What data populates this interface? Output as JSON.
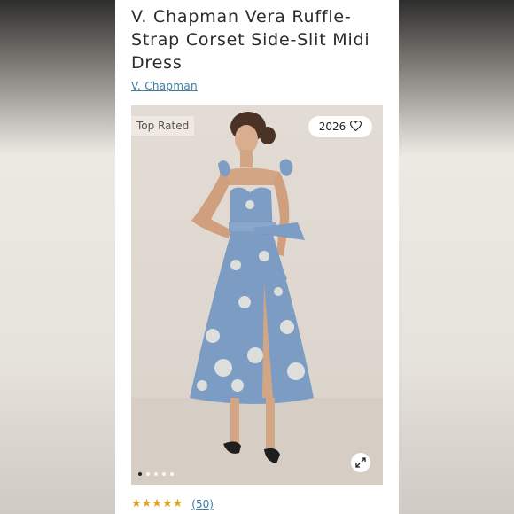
{
  "product": {
    "title": "V. Chapman Vera Ruffle-Strap Corset Side-Slit Midi Dress",
    "brand": "V. Chapman"
  },
  "image": {
    "badge": "Top Rated",
    "likes": "2026",
    "carousel_dots": 5,
    "active_dot": 0
  },
  "rating": {
    "stars": "★★★★★",
    "value": 4.5,
    "count": "(50)"
  },
  "colors": {
    "accent": "#3a7fa6",
    "star": "#d9a62b",
    "dress": "#7d9cc4"
  }
}
